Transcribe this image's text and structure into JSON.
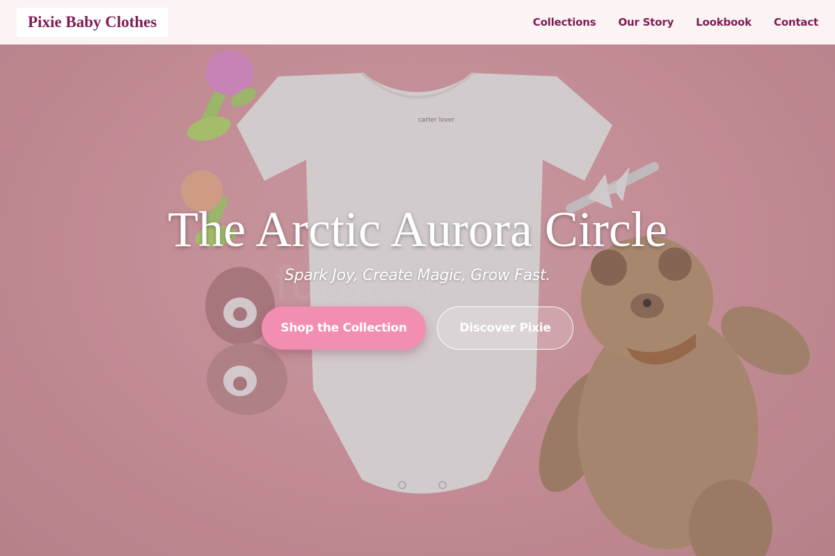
{
  "header": {
    "brand": "Pixie Baby Clothes",
    "nav": [
      "Collections",
      "Our Story",
      "Lookbook",
      "Contact"
    ]
  },
  "hero": {
    "title": "The Arctic Aurora Circle",
    "tagline": "Spark Joy, Create Magic, Grow Fast.",
    "primary_cta": "Shop the Collection",
    "secondary_cta": "Discover Pixie",
    "onesie_tag": "carter lover"
  },
  "colors": {
    "brand": "#7d1c52",
    "primary_button": "#f28eb2",
    "background_pink": "#e8adb4"
  },
  "icons": {
    "hero_image": "baby-flatlay-photo"
  }
}
